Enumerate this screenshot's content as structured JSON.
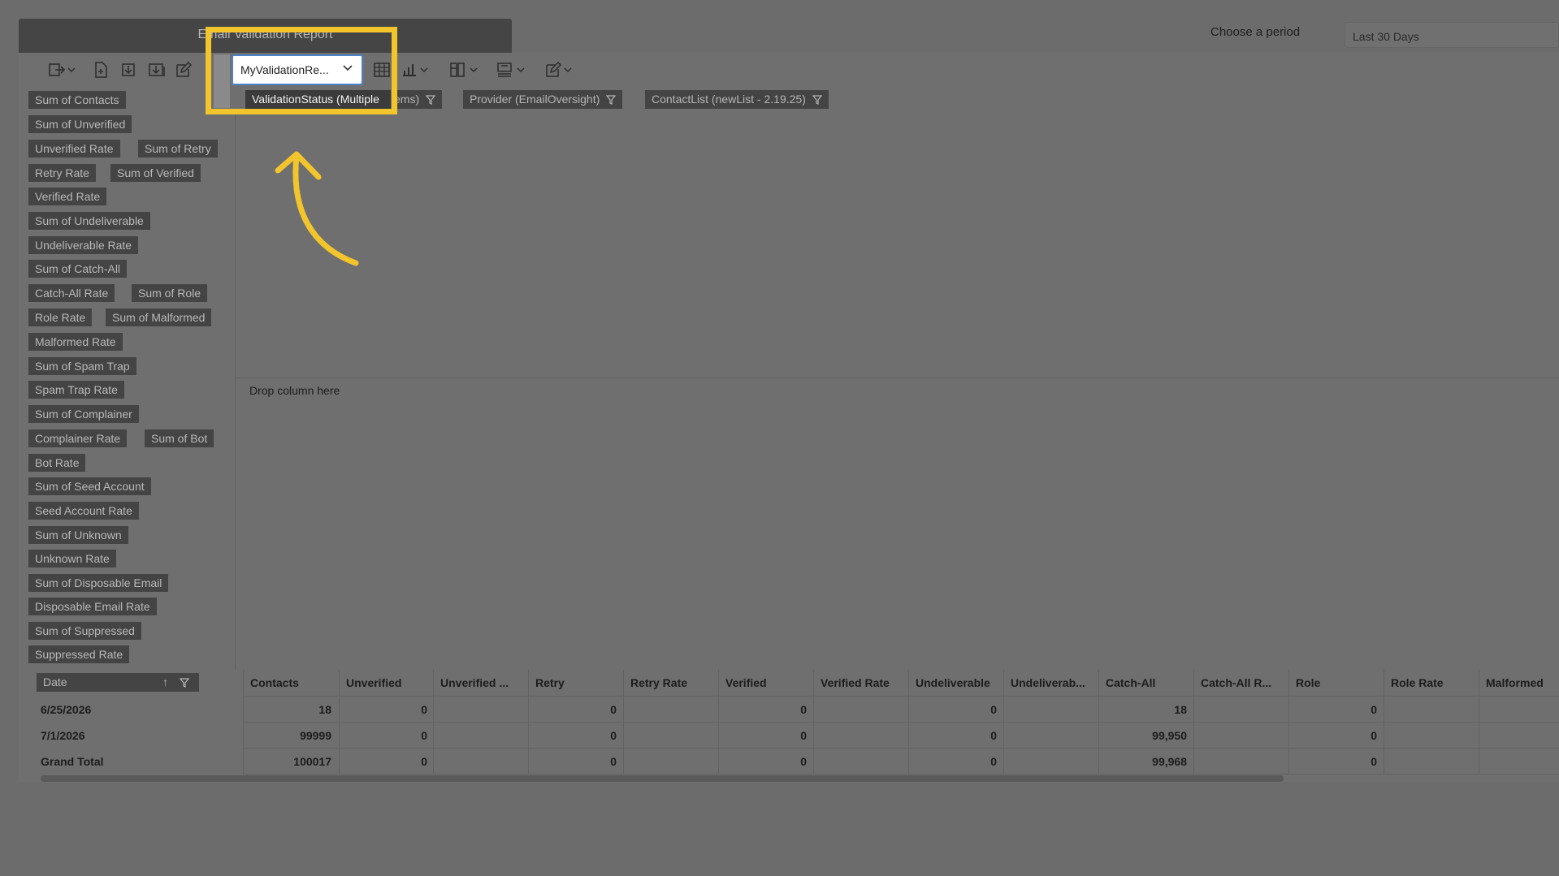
{
  "window": {
    "title": "Email Validation Report"
  },
  "period": {
    "label": "Choose a period",
    "value": "Last 30 Days"
  },
  "toolbar": {
    "layout_dropdown": "MyValidationRe...",
    "icons": [
      "export-icon",
      "new-file-icon",
      "import-icon",
      "save-as-icon",
      "edit-icon",
      "delete-icon",
      "grid-icon",
      "chart-icon",
      "layout-icon",
      "fields-icon",
      "format-icon"
    ]
  },
  "filters": [
    {
      "label": "ValidationStatus (Multiple"
    },
    {
      "label": "ems)"
    },
    {
      "label": "Provider (EmailOversight)"
    },
    {
      "label": "ContactList (newList - 2.19.25)"
    }
  ],
  "fields": [
    "Sum of Contacts",
    "Sum of Unverified",
    "Unverified Rate",
    "Sum of Retry",
    "Retry Rate",
    "Sum of Verified",
    "Verified Rate",
    "Sum of Undeliverable",
    "Undeliverable Rate",
    "Sum of Catch-All",
    "Catch-All Rate",
    "Sum of Role",
    "Role Rate",
    "Sum of Malformed",
    "Malformed Rate",
    "Sum of Spam Trap",
    "Spam Trap Rate",
    "Sum of Complainer",
    "Complainer Rate",
    "Sum of Bot",
    "Bot Rate",
    "Sum of Seed Account",
    "Seed Account Rate",
    "Sum of Unknown",
    "Unknown Rate",
    "Sum of Disposable Email",
    "Disposable Email Rate",
    "Sum of Suppressed",
    "Suppressed Rate"
  ],
  "drop_column": "Drop column here",
  "grid": {
    "row_field": "Date",
    "columns": [
      "Contacts",
      "Unverified",
      "Unverified ...",
      "Retry",
      "Retry Rate",
      "Verified",
      "Verified Rate",
      "Undeliverable",
      "Undeliverab...",
      "Catch-All",
      "Catch-All R...",
      "Role",
      "Role Rate",
      "Malformed"
    ],
    "rows": [
      {
        "label": "6/25/2026",
        "values": [
          "18",
          "0",
          "",
          "0",
          "",
          "0",
          "",
          "0",
          "",
          "18",
          "",
          "0",
          "",
          ""
        ]
      },
      {
        "label": "7/1/2026",
        "values": [
          "99999",
          "0",
          "",
          "0",
          "",
          "0",
          "",
          "0",
          "",
          "99,950",
          "",
          "0",
          "",
          ""
        ]
      },
      {
        "label": "Grand Total",
        "values": [
          "100017",
          "0",
          "",
          "0",
          "",
          "0",
          "",
          "0",
          "",
          "99,968",
          "",
          "0",
          "",
          ""
        ]
      }
    ]
  },
  "colors": {
    "highlight": "#f3c52c",
    "overlay": "#6c6c6c"
  }
}
